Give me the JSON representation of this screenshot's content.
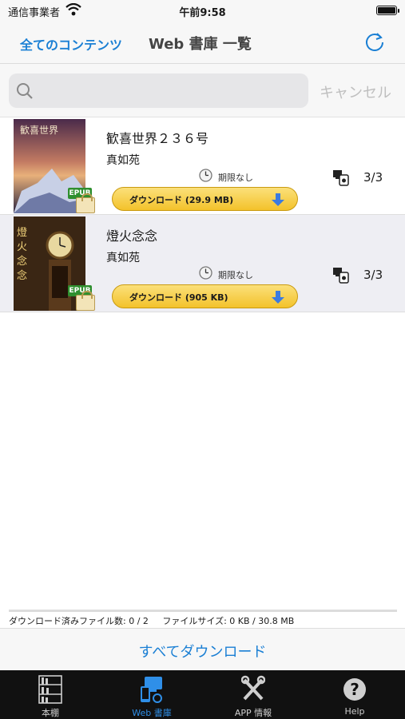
{
  "status": {
    "carrier": "通信事業者",
    "time": "午前9:58"
  },
  "nav": {
    "back_label": "全てのコンテンツ",
    "title": "Web 書庫 一覧",
    "refresh_icon": "refresh-icon"
  },
  "search": {
    "value": "",
    "placeholder": "",
    "cancel_label": "キャンセル"
  },
  "books": [
    {
      "title": "歓喜世界２３６号",
      "author": "真如苑",
      "expiry": "期限なし",
      "download_label": "ダウンロード (29.9 MB)",
      "device_count": "3/3",
      "format": "EPUB"
    },
    {
      "title": "燈火念念",
      "author": "真如苑",
      "expiry": "期限なし",
      "download_label": "ダウンロード (905 KB)",
      "device_count": "3/3",
      "format": "EPUB"
    }
  ],
  "footer": {
    "downloaded": "ダウンロード済みファイル数: 0 / 2",
    "filesize": "ファイルサイズ: 0 KB / 30.8 MB",
    "download_all_label": "すべてダウンロード"
  },
  "tabs": [
    {
      "label": "本棚",
      "icon": "bookshelf-icon",
      "active": false
    },
    {
      "label": "Web 書庫",
      "icon": "web-library-icon",
      "active": true
    },
    {
      "label": "APP 情報",
      "icon": "tools-icon",
      "active": false
    },
    {
      "label": "Help",
      "icon": "help-icon",
      "active": false
    }
  ],
  "colors": {
    "accent": "#1a7fd4",
    "button": "#f3c22b",
    "tab_bg": "#111111",
    "tab_active": "#2f8fe8"
  }
}
